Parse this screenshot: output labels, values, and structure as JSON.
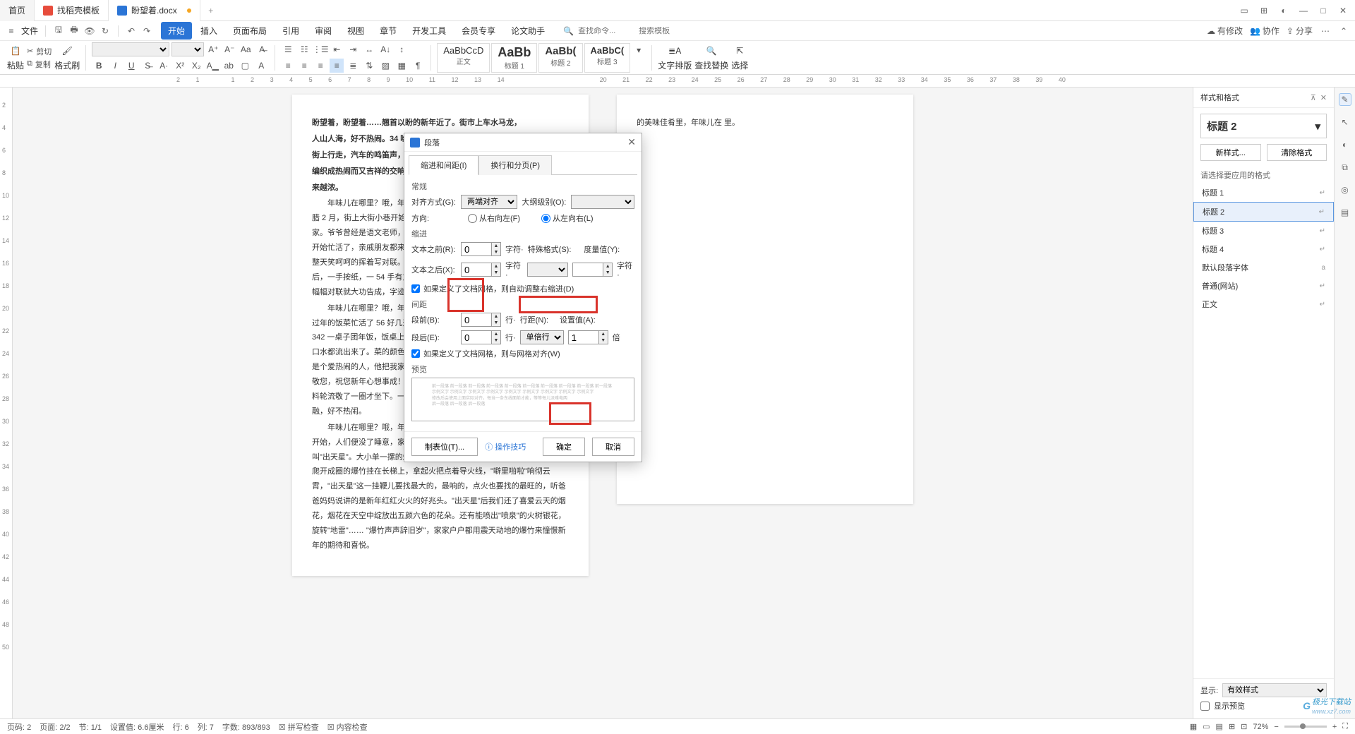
{
  "titlebar": {
    "tabs": [
      {
        "label": "首页"
      },
      {
        "label": "找稻壳模板"
      },
      {
        "label": "盼望着.docx"
      }
    ],
    "plus": "+"
  },
  "menubar": {
    "file": "文件",
    "tabs": [
      "开始",
      "插入",
      "页面布局",
      "引用",
      "审阅",
      "视图",
      "章节",
      "开发工具",
      "会员专享",
      "论文助手"
    ],
    "search_cmd_ph": "查找命令...",
    "search_tpl_ph": "搜索模板",
    "right": {
      "track": "有修改",
      "coop": "协作",
      "share": "分享"
    }
  },
  "ribbon": {
    "paste": "粘贴",
    "cut": "剪切",
    "copy": "复制",
    "fmtpainter": "格式刷",
    "styles": [
      {
        "preview": "AaBbCcD",
        "label": "正文"
      },
      {
        "preview": "AaBb",
        "label": "标题 1"
      },
      {
        "preview": "AaBb(",
        "label": "标题 2"
      },
      {
        "preview": "AaBbC(",
        "label": "标题 3"
      }
    ],
    "textlayout": "文字排版",
    "findreplace": "查找替换",
    "select": "选择"
  },
  "rightpane": {
    "title": "样式和格式",
    "current_style": "标题 2",
    "new_btn": "新样式...",
    "clear_btn": "清除格式",
    "prompt": "请选择要应用的格式",
    "items": [
      "标题 1",
      "标题 2",
      "标题 3",
      "标题 4",
      "默认段落字体",
      "普通(网站)",
      "正文"
    ],
    "selected_index": 1,
    "show_label": "显示:",
    "show_value": "有效样式",
    "show_preview": "显示预览"
  },
  "statusbar": {
    "page_no": "页码: 2",
    "page": "页面: 2/2",
    "section": "节: 1/1",
    "pos": "设置值: 6.6厘米",
    "line": "行: 6",
    "col": "列: 7",
    "words": "字数: 893/893",
    "spell": "拼写检查",
    "content": "内容检查",
    "zoom": "72%"
  },
  "dialog": {
    "title": "段落",
    "tab1": "缩进和间距(I)",
    "tab2": "换行和分页(P)",
    "sec_general": "常规",
    "align_label": "对齐方式(G):",
    "align_value": "两端对齐",
    "outline_label": "大纲级别(O):",
    "outline_value": "",
    "direction_label": "方向:",
    "dir_rtl": "从右向左(F)",
    "dir_ltr": "从左向右(L)",
    "sec_indent": "缩进",
    "before_text": "文本之前(R):",
    "before_text_val": "0",
    "unit_char": "字符·",
    "special_label": "特殊格式(S):",
    "metric_label": "度量值(Y):",
    "after_text": "文本之后(X):",
    "after_text_val": "0",
    "chk_grid_indent": "如果定义了文档网格，则自动调整右缩进(D)",
    "sec_spacing": "间距",
    "before_para": "段前(B):",
    "before_para_val": "0",
    "unit_line": "行·",
    "linespacing_label": "行距(N):",
    "setvalue_label": "设置值(A):",
    "after_para": "段后(E):",
    "after_para_val": "0",
    "linespacing_value": "单倍行距",
    "setvalue_val": "1",
    "unit_times": "倍",
    "chk_grid_align": "如果定义了文档网格，则与网格对齐(W)",
    "sec_preview": "预览",
    "tabs_btn": "制表位(T)...",
    "tips": "操作技巧",
    "ok": "确定",
    "cancel": "取消"
  },
  "doc": {
    "p1_l1": "盼望着，盼望着……翘首以盼的新年近了。街市上车水马龙，",
    "p1_l2": "人山人海，好不热闹。34 咝，拎着大大小小行李箱的人在",
    "p1_l3": "街上行走，汽车的鸣笛声，商店的叫卖声，人的脚步声……",
    "p1_l4": "编织成热闹而又吉祥的交响乐。新年的脚步近了，年味儿越",
    "p1_l5": "来越浓。",
    "p2a": "年味儿在哪里？哦，年味儿 55 在爷爷一幅幅蕴笺飘香的对联里。进入腊 2 月，街上大街小巷开始卖起了大红的长纸，我们就 86 买来送到爷爷家。爷爷曾经是语文老师，写的 67 一手好行书字。所以一到腊月，爷爷就开始忙活了，亲戚朋友都来了红纸拿到爷爷家请他写对联。爷爷也乐意，3 整天笑呵呵的挥着写对联。只见爷爷 9 把毛笔杆头支着下巴作沉思状，然后，一手按纸，一 54 手有力的握笔，醮墨、“刷刷刷”，一会儿下功夫，一幅幅对联就大功告成，字迹劲有力。",
    "p2b": "年味儿在哪里？哦，年味儿在一桌桌香喷喷的菜肴里。腊月底，妈妈为过年的饭菜忙活了 56 好几天。除夕那天，一上午的时间，妈妈就做了将 342 一桌子团年饭，饭桌上热气腾腾，香气扑鼻 08 而来，我深吸一口气，口水都流出来了。菜的颜色也经过妈妈细心搭配，让人看了就有食欲。爸爸是个爱热闹的人，他把我家所以的亲戚全接到家里来吃团年饭，\"表叔，我敬您，祝您新年心想事成！\" \"姑姑，我敬您，祝您新年健康快乐！\"我喝饮料轮流敬了一圈才坐下。一大家人欢聚在一起互相敬酒，互相祝福，其乐融融，好不热闹。",
    "p2c": "年味儿在哪里？哦，年味儿在那震耳欲聋的爆竹声中。新年第一天零点开始，人们便没了睡意，家家户户老老小小都拥起来放爆竹，我们那里叫\"出天星\"。大小单一摞的爆竹串成串儿，卷成圈，放之前要找一个长梯，爬开成圈的爆竹挂在长梯上，拿起火把点着导火线，\"噼里啪啦\"响彻云霄，\"出天星\"这一挂鞭儿要找最大的，最响的，点火也要找的最旺的，听爸爸妈妈说讲的是新年红红火火的好兆头。\"出天星\"后我们还了喜爱云天的烟花，烟花在天空中绽放出五颜六色的花朵。还有能喷出\"喷泉\"的火树银花，旋转\"地雷\"…… \"爆竹声声辞旧岁\"，家家户户都用震天动地的爆竹来憧憬新年的期待和喜悦。",
    "page2_right": "的美味佳肴里，年味儿在    里。"
  },
  "watermark": {
    "brand": "极光下载站",
    "url": "www.xz7.com"
  }
}
